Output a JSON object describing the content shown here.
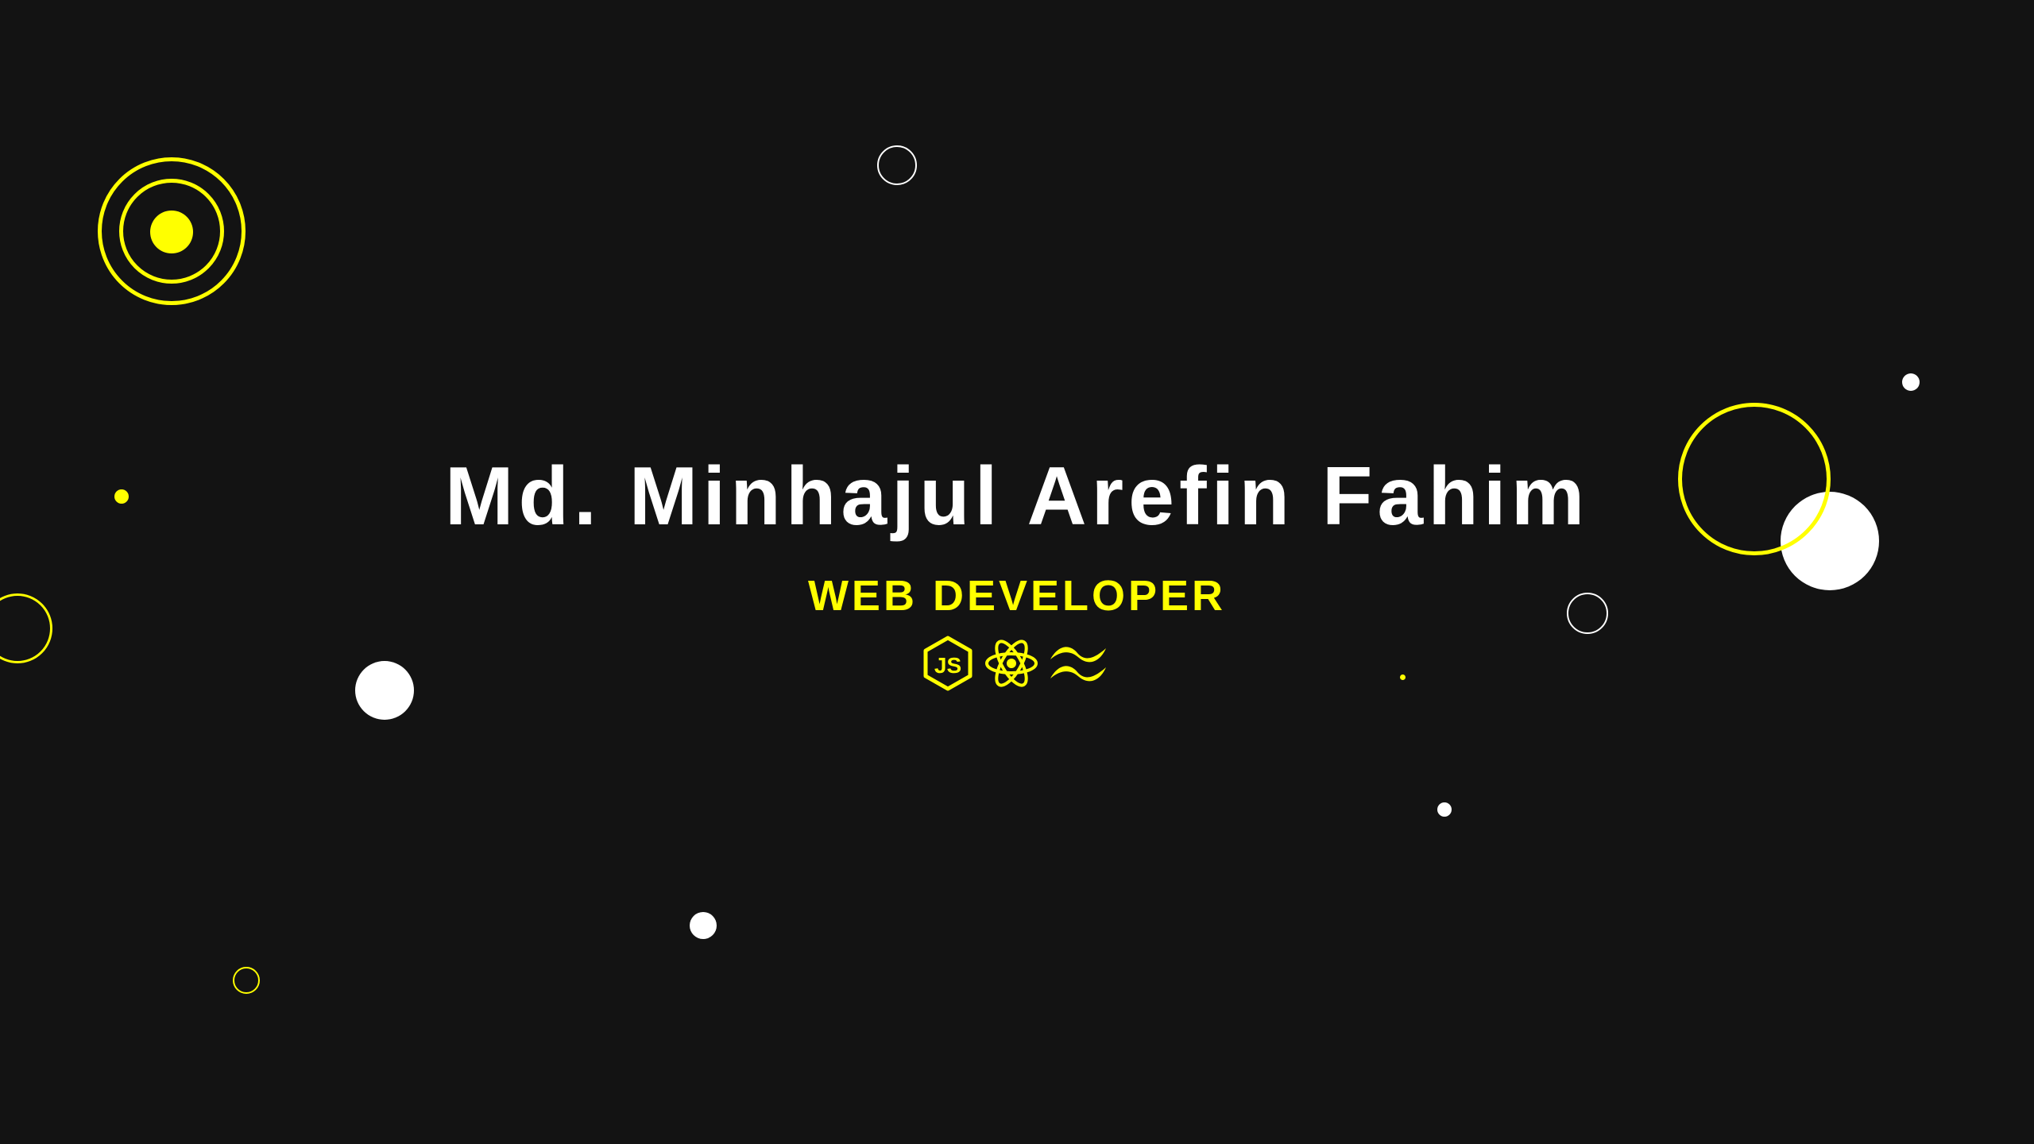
{
  "hero": {
    "name": "Md. Minhajul Arefin Fahim",
    "role": "WEB DEVELOPER"
  },
  "tech_icons": [
    "nodejs-icon",
    "react-icon",
    "tailwind-icon"
  ],
  "colors": {
    "background": "#131313",
    "accent": "#ffff00",
    "text": "#ffffff"
  }
}
